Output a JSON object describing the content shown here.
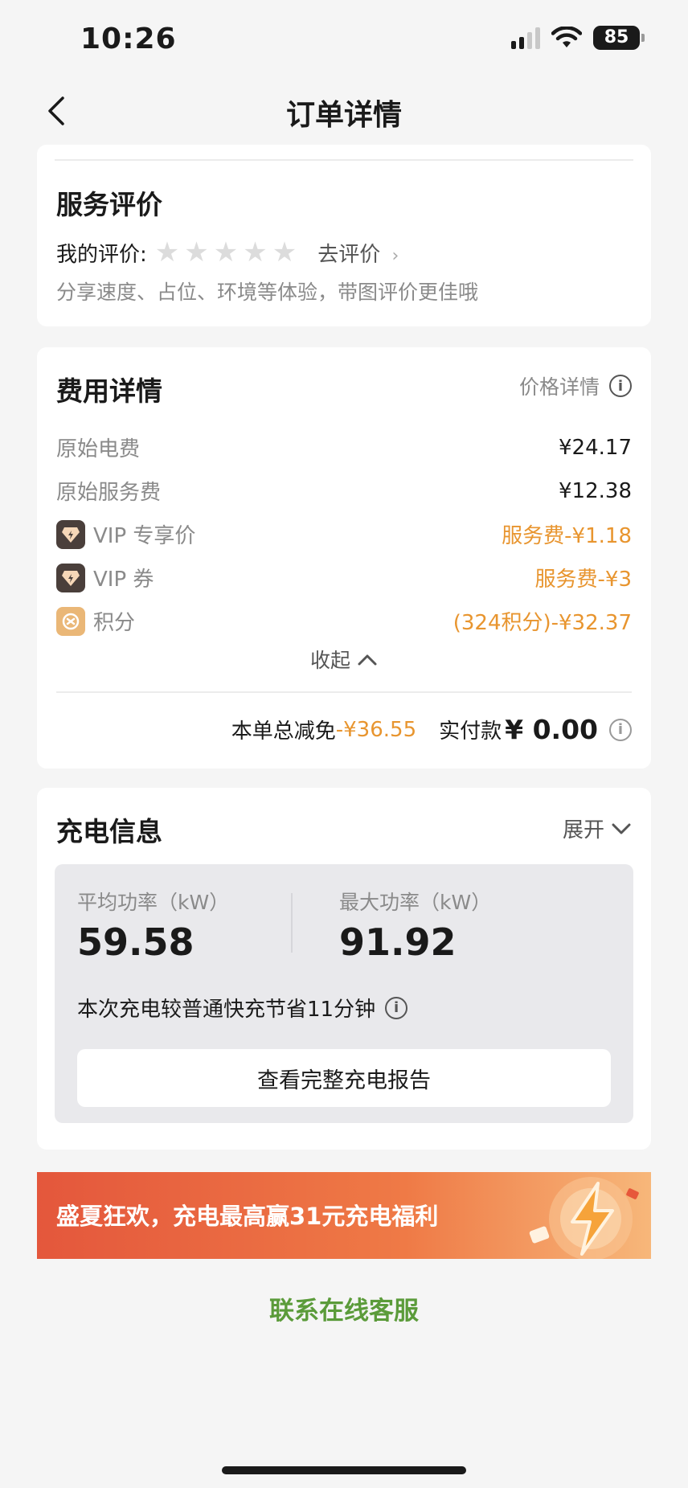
{
  "status": {
    "time": "10:26",
    "battery": "85"
  },
  "nav": {
    "title": "订单详情"
  },
  "review": {
    "title": "服务评价",
    "my_rating_label": "我的评价:",
    "go_review": "去评价",
    "hint": "分享速度、占位、环境等体验，带图评价更佳哦",
    "stars": 0
  },
  "fees": {
    "title": "费用详情",
    "price_detail": "价格详情",
    "items": [
      {
        "label": "原始电费",
        "value": "¥24.17"
      },
      {
        "label": "原始服务费",
        "value": "¥12.38"
      },
      {
        "label": "VIP 专享价",
        "value": "服务费-¥1.18"
      },
      {
        "label": "VIP 券",
        "value": "服务费-¥3"
      },
      {
        "label": "积分",
        "value": "(324积分)-¥32.37"
      }
    ],
    "collapse": "收起",
    "total_discount_label": "本单总减免",
    "total_discount_value": "-¥36.55",
    "paid_label": "实付款",
    "paid_value": "¥ 0.00"
  },
  "charge": {
    "title": "充电信息",
    "expand": "展开",
    "avg_power_label": "平均功率（kW）",
    "avg_power_value": "59.58",
    "max_power_label": "最大功率（kW）",
    "max_power_value": "91.92",
    "saving_text": "本次充电较普通快充节省11分钟",
    "report_button": "查看完整充电报告"
  },
  "banner": {
    "text": "盛夏狂欢，充电最高赢31元充电福利"
  },
  "support": {
    "label": "联系在线客服"
  },
  "colors": {
    "accent_orange": "#e8952f",
    "support_green": "#5b9b3a",
    "banner_red": "#e4573c"
  }
}
